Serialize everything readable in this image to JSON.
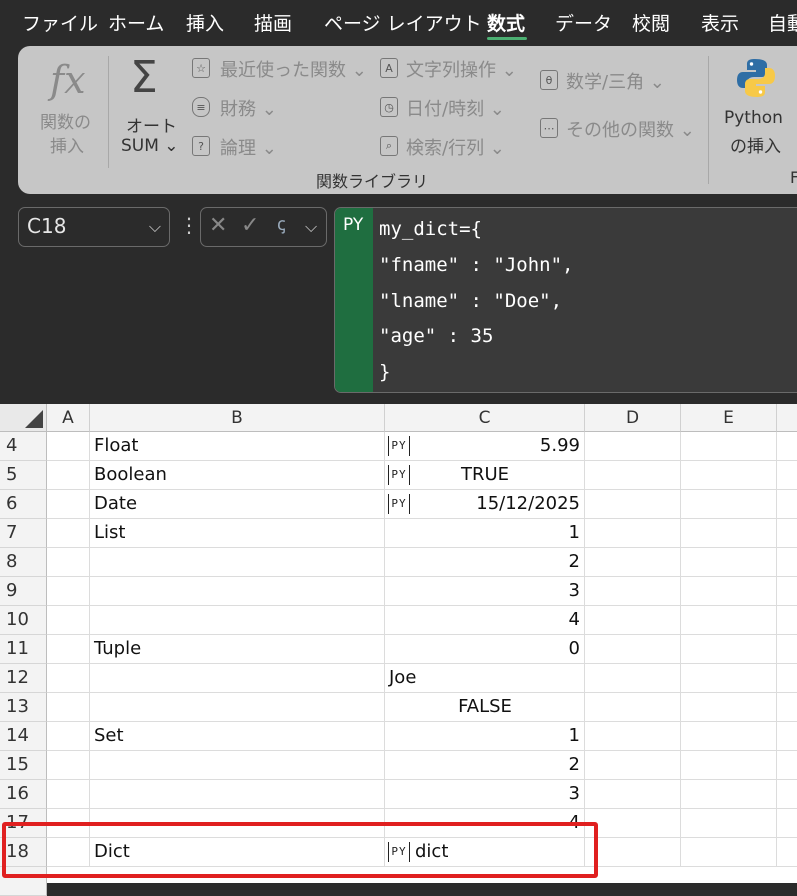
{
  "menu": [
    "ファイル",
    "ホーム",
    "挿入",
    "描画",
    "ページ レイアウト",
    "数式",
    "データ",
    "校閲",
    "表示",
    "自動"
  ],
  "active_tab": "数式",
  "ribbon": {
    "insert_function": [
      "関数の",
      "挿入"
    ],
    "autosum": [
      "オート",
      "SUM ⌄"
    ],
    "recent": "最近使った関数 ⌄",
    "financial": "財務 ⌄",
    "logical": "論理 ⌄",
    "text": "文字列操作 ⌄",
    "datetime": "日付/時刻 ⌄",
    "lookup": "検索/行列 ⌄",
    "math": "数学/三角 ⌄",
    "other": "その他の関数 ⌄",
    "python": [
      "Python",
      "の挿入"
    ],
    "group_label": "関数ライブラリ",
    "group_label2": "F"
  },
  "formula_bar": {
    "name_box": "C18",
    "py_label": "PY",
    "code": [
      "my_dict={",
      "\"fname\" : \"John\",",
      "\"lname\" : \"Doe\",",
      "\"age\" : 35",
      "}"
    ]
  },
  "columns": [
    "A",
    "B",
    "C",
    "D",
    "E"
  ],
  "rows": [
    {
      "num": "4",
      "b": "Float",
      "c": "5.99",
      "c_align": "right",
      "py": true
    },
    {
      "num": "5",
      "b": "Boolean",
      "c": "TRUE",
      "c_align": "center",
      "py": true
    },
    {
      "num": "6",
      "b": "Date",
      "c": "15/12/2025",
      "c_align": "right",
      "py": true
    },
    {
      "num": "7",
      "b": "List",
      "c": "1",
      "c_align": "right",
      "py": false
    },
    {
      "num": "8",
      "b": "",
      "c": "2",
      "c_align": "right",
      "py": false
    },
    {
      "num": "9",
      "b": "",
      "c": "3",
      "c_align": "right",
      "py": false
    },
    {
      "num": "10",
      "b": "",
      "c": "4",
      "c_align": "right",
      "py": false
    },
    {
      "num": "11",
      "b": "Tuple",
      "c": "0",
      "c_align": "right",
      "py": false
    },
    {
      "num": "12",
      "b": "",
      "c": "Joe",
      "c_align": "left",
      "py": false
    },
    {
      "num": "13",
      "b": "",
      "c": "FALSE",
      "c_align": "center",
      "py": false
    },
    {
      "num": "14",
      "b": "Set",
      "c": "1",
      "c_align": "right",
      "py": false
    },
    {
      "num": "15",
      "b": "",
      "c": "2",
      "c_align": "right",
      "py": false
    },
    {
      "num": "16",
      "b": "",
      "c": "3",
      "c_align": "right",
      "py": false
    },
    {
      "num": "17",
      "b": "",
      "c": "4",
      "c_align": "right",
      "py": false
    },
    {
      "num": "18",
      "b": "Dict",
      "c": "dict",
      "c_align": "left",
      "py": true
    }
  ],
  "py_cell_badge": "PY",
  "colors": {
    "accent": "#1f6e40",
    "highlight": "#e02020"
  }
}
